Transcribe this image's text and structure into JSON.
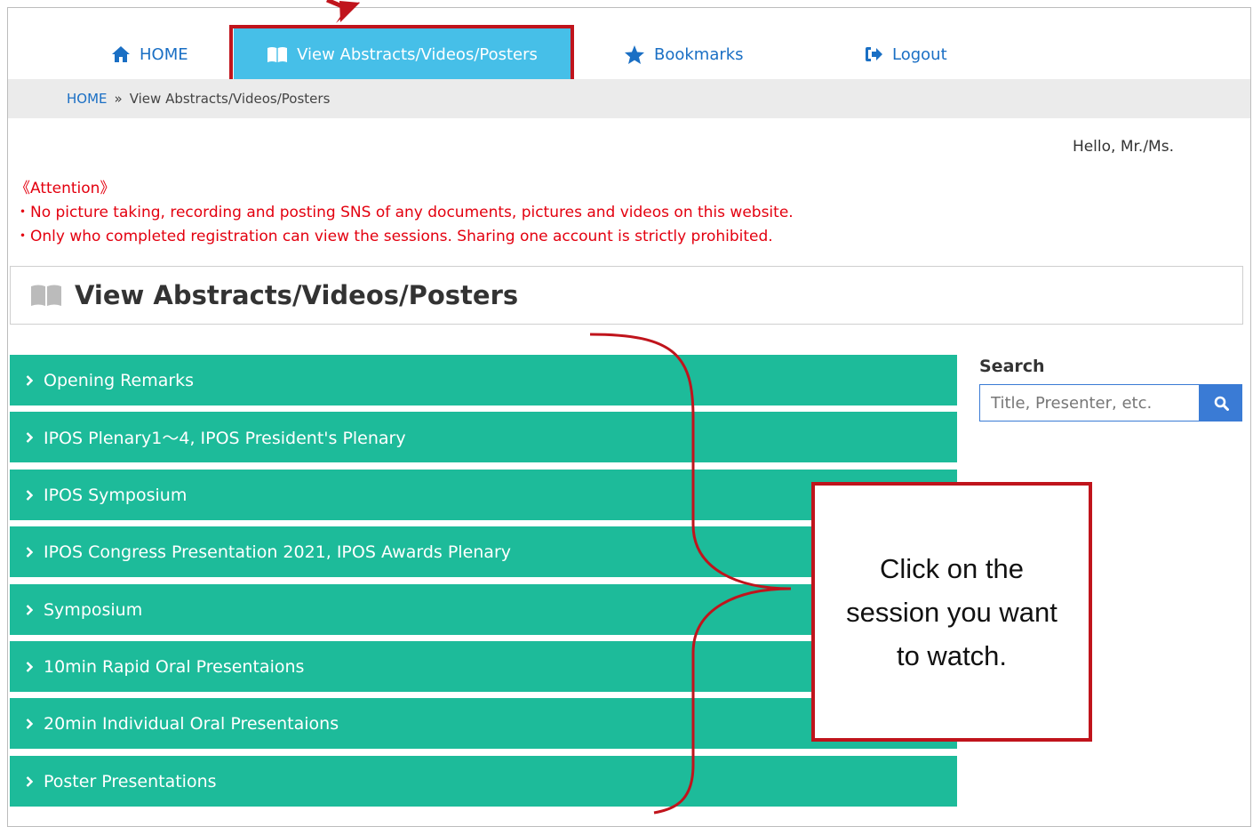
{
  "nav": {
    "home_label": "HOME",
    "view_label": "View Abstracts/Videos/Posters",
    "bookmarks_label": "Bookmarks",
    "logout_label": "Logout"
  },
  "breadcrumb": {
    "home": "HOME",
    "separator": "»",
    "current": "View Abstracts/Videos/Posters"
  },
  "greeting": "Hello, Mr./Ms.",
  "attention": {
    "title": "《Attention》",
    "lines": [
      "・No picture taking, recording and posting SNS of any documents, pictures and videos on this website.",
      "・Only who completed registration can view the sessions. Sharing one account is strictly prohibited."
    ]
  },
  "page_title": "View Abstracts/Videos/Posters",
  "sessions": [
    "Opening Remarks",
    "IPOS Plenary1～4, IPOS President's Plenary",
    "IPOS Symposium",
    "IPOS Congress Presentation 2021, IPOS Awards Plenary",
    "Symposium",
    "10min Rapid Oral Presentaions",
    "20min Individual Oral Presentaions",
    "Poster Presentations"
  ],
  "search": {
    "label": "Search",
    "placeholder": "Title, Presenter, etc."
  },
  "callout": "Click on the session you want to watch.",
  "colors": {
    "nav_link": "#1a6fc4",
    "nav_active_bg": "#46bfe8",
    "session_bg": "#1dbb9a",
    "attention": "#e3000f",
    "annotation_red": "#c0141c",
    "search_blue": "#3a7bd5"
  }
}
